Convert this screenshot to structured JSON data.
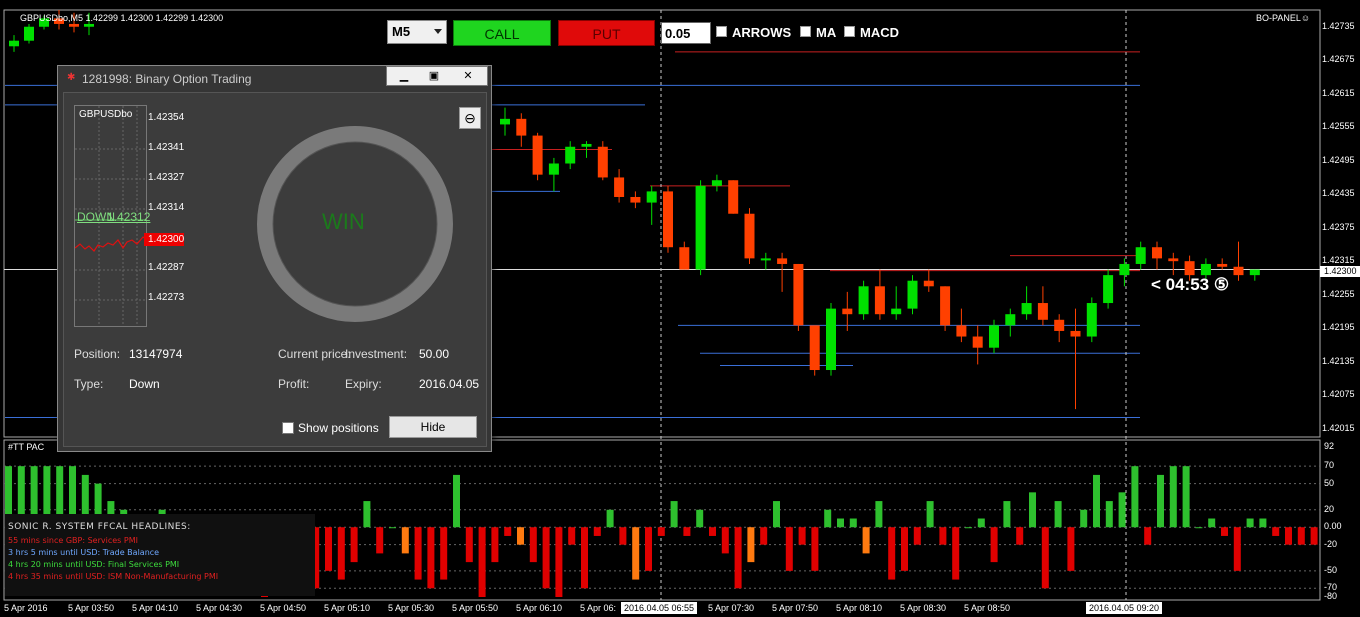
{
  "chart_title": "GBPUSDbo,M5  1.42299 1.42300 1.42299 1.42300",
  "panel_name": "BO-PANEL☺",
  "toolbar": {
    "timeframe": "M5",
    "call_label": "CALL",
    "put_label": "PUT",
    "amount": "0.05",
    "arrows_label": "ARROWS",
    "ma_label": "MA",
    "macd_label": "MACD"
  },
  "price_axis": [
    "1.42735",
    "1.42675",
    "1.42615",
    "1.42555",
    "1.42495",
    "1.42435",
    "1.42375",
    "1.42315",
    "1.42255",
    "1.42195",
    "1.42135",
    "1.42075",
    "1.42015"
  ],
  "current_price": "1.42300",
  "countdown": "< 04:53 ⑤",
  "indicator": {
    "name": "#TT PAC",
    "axis": [
      "92",
      "70",
      "50",
      "20",
      "0.00",
      "-20",
      "-50",
      "-70",
      "-80"
    ]
  },
  "time_axis": [
    "5 Apr 2016",
    "5 Apr 03:50",
    "5 Apr 04:10",
    "5 Apr 04:30",
    "5 Apr 04:50",
    "5 Apr 05:10",
    "5 Apr 05:30",
    "5 Apr 05:50",
    "5 Apr 06:10",
    "5 Apr 06:",
    "5 Apr 07:10",
    "5 Apr 07:30",
    "5 Apr 07:50",
    "5 Apr 08:10",
    "5 Apr 08:30",
    "5 Apr 08:50"
  ],
  "time_highlights": [
    "2016.04.05 06:55",
    "2016.04.05 09:20"
  ],
  "news": {
    "title": "SONIC R. SYSTEM  FFCAL HEADLINES:",
    "lines": [
      {
        "text": "55 mins since GBP: Services PMI",
        "color": "#e02020"
      },
      {
        "text": "3 hrs 5 mins until USD: Trade Balance",
        "color": "#6fa8ff"
      },
      {
        "text": "4 hrs 20 mins until USD: Final Services PMI",
        "color": "#3ddc3d"
      },
      {
        "text": "4 hrs 35 mins until USD: ISM Non-Manufacturing PMI",
        "color": "#e02020"
      }
    ]
  },
  "dialog": {
    "title": "1281998: Binary Option Trading",
    "mini_symbol": "GBPUSDbo",
    "mini_prices": [
      "1.42354",
      "1.42341",
      "1.42327",
      "1.42314",
      "1.42287",
      "1.42273"
    ],
    "mini_current": "1.42300",
    "direction_label": "DOWN",
    "direction_price": "1.42312",
    "result": "WIN",
    "position_label": "Position:",
    "position_value": "13147974",
    "type_label": "Type:",
    "type_value": "Down",
    "current_price_label": "Current price:",
    "investment_label": "Investment:",
    "investment_value": "50.00",
    "profit_label": "Profit:",
    "expiry_label": "Expiry:",
    "expiry_value": "2016.04.05",
    "show_positions_label": "Show positions",
    "hide_label": "Hide"
  },
  "colors": {
    "bull": "#00e000",
    "bear": "#ff4000",
    "level_red": "#c82020",
    "level_blue": "#3a6fd8",
    "ind_green": "#2ec02e",
    "ind_red": "#e00000",
    "ind_orange": "#ff7a10"
  },
  "candles": [
    [
      1.427,
      1.4272,
      1.4269,
      1.4271
    ],
    [
      1.4271,
      1.4274,
      1.42705,
      1.42735
    ],
    [
      1.42735,
      1.42755,
      1.4273,
      1.4275
    ],
    [
      1.4275,
      1.42765,
      1.4273,
      1.4274
    ],
    [
      1.4274,
      1.4276,
      1.42725,
      1.42735
    ],
    [
      1.42735,
      1.4276,
      1.4272,
      1.4274
    ],
    [
      1.4256,
      1.4259,
      1.4254,
      1.4257
    ],
    [
      1.4257,
      1.4258,
      1.4252,
      1.4254
    ],
    [
      1.4254,
      1.42545,
      1.4246,
      1.4247
    ],
    [
      1.4247,
      1.425,
      1.4244,
      1.4249
    ],
    [
      1.4249,
      1.4253,
      1.4248,
      1.4252
    ],
    [
      1.4252,
      1.4253,
      1.425,
      1.42525
    ],
    [
      1.4252,
      1.4253,
      1.4246,
      1.42465
    ],
    [
      1.42465,
      1.4248,
      1.4242,
      1.4243
    ],
    [
      1.4243,
      1.4244,
      1.4241,
      1.4242
    ],
    [
      1.4242,
      1.4245,
      1.4238,
      1.4244
    ],
    [
      1.4244,
      1.4245,
      1.4233,
      1.4234
    ],
    [
      1.4234,
      1.4235,
      1.423,
      1.423
    ],
    [
      1.423,
      1.4246,
      1.4229,
      1.4245
    ],
    [
      1.4245,
      1.4247,
      1.4244,
      1.4246
    ],
    [
      1.4246,
      1.4246,
      1.424,
      1.424
    ],
    [
      1.424,
      1.4241,
      1.4231,
      1.4232
    ],
    [
      1.4232,
      1.4233,
      1.423,
      1.4232
    ],
    [
      1.4232,
      1.4233,
      1.4226,
      1.4231
    ],
    [
      1.4231,
      1.4231,
      1.4219,
      1.422
    ],
    [
      1.422,
      1.422,
      1.4211,
      1.4212
    ],
    [
      1.4212,
      1.4224,
      1.4211,
      1.4223
    ],
    [
      1.4223,
      1.4226,
      1.4219,
      1.4222
    ],
    [
      1.4222,
      1.4228,
      1.4221,
      1.4227
    ],
    [
      1.4227,
      1.423,
      1.4221,
      1.4222
    ],
    [
      1.4222,
      1.4227,
      1.4221,
      1.4223
    ],
    [
      1.4223,
      1.4229,
      1.4222,
      1.4228
    ],
    [
      1.4228,
      1.423,
      1.4226,
      1.4227
    ],
    [
      1.4227,
      1.4227,
      1.4219,
      1.422
    ],
    [
      1.422,
      1.4223,
      1.4217,
      1.4218
    ],
    [
      1.4218,
      1.422,
      1.4213,
      1.4216
    ],
    [
      1.4216,
      1.4221,
      1.4215,
      1.422
    ],
    [
      1.422,
      1.4223,
      1.4218,
      1.4222
    ],
    [
      1.4222,
      1.4227,
      1.4221,
      1.4224
    ],
    [
      1.4224,
      1.4227,
      1.422,
      1.4221
    ],
    [
      1.4221,
      1.4222,
      1.4217,
      1.4219
    ],
    [
      1.4219,
      1.4223,
      1.4205,
      1.4218
    ],
    [
      1.4218,
      1.4225,
      1.4217,
      1.4224
    ],
    [
      1.4224,
      1.423,
      1.4223,
      1.4229
    ],
    [
      1.4229,
      1.4232,
      1.4227,
      1.4231
    ],
    [
      1.4231,
      1.4235,
      1.423,
      1.4234
    ],
    [
      1.4234,
      1.4235,
      1.423,
      1.4232
    ],
    [
      1.4232,
      1.4233,
      1.4229,
      1.42315
    ],
    [
      1.42315,
      1.42325,
      1.4228,
      1.4229
    ],
    [
      1.4229,
      1.4232,
      1.4228,
      1.4231
    ],
    [
      1.4231,
      1.4232,
      1.423,
      1.42305
    ],
    [
      1.42305,
      1.4235,
      1.4228,
      1.4229
    ],
    [
      1.4229,
      1.423,
      1.4228,
      1.423
    ]
  ],
  "indicator_values": [
    70,
    70,
    70,
    70,
    70,
    70,
    60,
    50,
    30,
    20,
    10,
    5,
    20,
    0,
    0,
    0,
    0,
    -20,
    -20,
    -60,
    -80,
    -70,
    -20,
    -60,
    -70,
    -50,
    -60,
    -40,
    30,
    -30,
    0,
    -30,
    -60,
    -70,
    -60,
    60,
    -40,
    -80,
    -40,
    -10,
    -20,
    -40,
    -70,
    -80,
    -20,
    -70,
    -10,
    20,
    -20,
    -60,
    -50,
    -10,
    30,
    -10,
    20,
    -10,
    -30,
    -70,
    -40,
    -20,
    30,
    -50,
    -20,
    -50,
    20,
    10,
    10,
    -30,
    30,
    -60,
    -50,
    -20,
    30,
    -20,
    -60,
    0,
    10,
    -40,
    30,
    -20,
    40,
    -70,
    30,
    -50,
    20,
    60,
    30,
    40,
    70,
    -20,
    60,
    70,
    70,
    0,
    10,
    -10,
    -50,
    10,
    10,
    -10,
    -20,
    -20,
    -20
  ]
}
